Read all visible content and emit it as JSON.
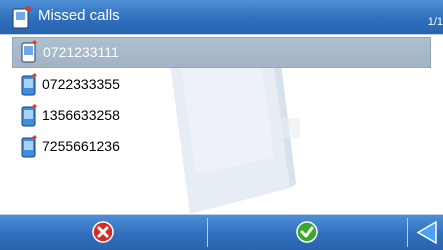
{
  "window": {
    "title": "Missed calls",
    "page_indicator": "1/1"
  },
  "list": {
    "items": [
      {
        "number": "0721233111",
        "selected": true
      },
      {
        "number": "0722333355",
        "selected": false
      },
      {
        "number": "1356633258",
        "selected": false
      },
      {
        "number": "7255661236",
        "selected": false
      }
    ]
  },
  "toolbar": {
    "cancel_icon": "x-circle-icon",
    "ok_icon": "checkmark-circle-icon",
    "back_icon": "triangle-left-icon"
  },
  "colors": {
    "bar_blue": "#2f6fbe",
    "selection": "#a8b9ca",
    "cancel_red": "#d62b20",
    "ok_green": "#3aa92a"
  }
}
